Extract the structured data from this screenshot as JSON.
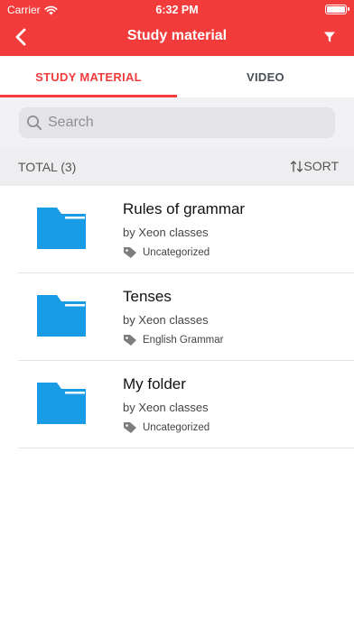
{
  "status_bar": {
    "carrier": "Carrier",
    "time": "6:32 PM",
    "wifi_icon": "wifi-icon",
    "battery_icon": "battery-icon",
    "battery_level": 1.0
  },
  "nav": {
    "title": "Study material",
    "back_icon": "chevron-left-icon",
    "filter_icon": "filter-icon"
  },
  "colors": {
    "accent": "#f23c3c",
    "folder": "#1a9be6",
    "tag_icon": "#7d7d7d"
  },
  "tabs": [
    {
      "label": "STUDY MATERIAL",
      "active": true
    },
    {
      "label": "VIDEO",
      "active": false
    }
  ],
  "search": {
    "placeholder": "Search",
    "value": "",
    "icon": "search-icon"
  },
  "list_header": {
    "total": "TOTAL (3)",
    "sort_label": "SORT",
    "sort_icon": "sort-arrows-icon"
  },
  "items": [
    {
      "title": "Rules of grammar",
      "author": "by Xeon classes",
      "tag": "Uncategorized",
      "icon": "folder-icon"
    },
    {
      "title": "Tenses",
      "author": "by Xeon classes",
      "tag": "English Grammar",
      "icon": "folder-icon"
    },
    {
      "title": "My folder",
      "author": "by Xeon classes",
      "tag": "Uncategorized",
      "icon": "folder-icon"
    }
  ]
}
